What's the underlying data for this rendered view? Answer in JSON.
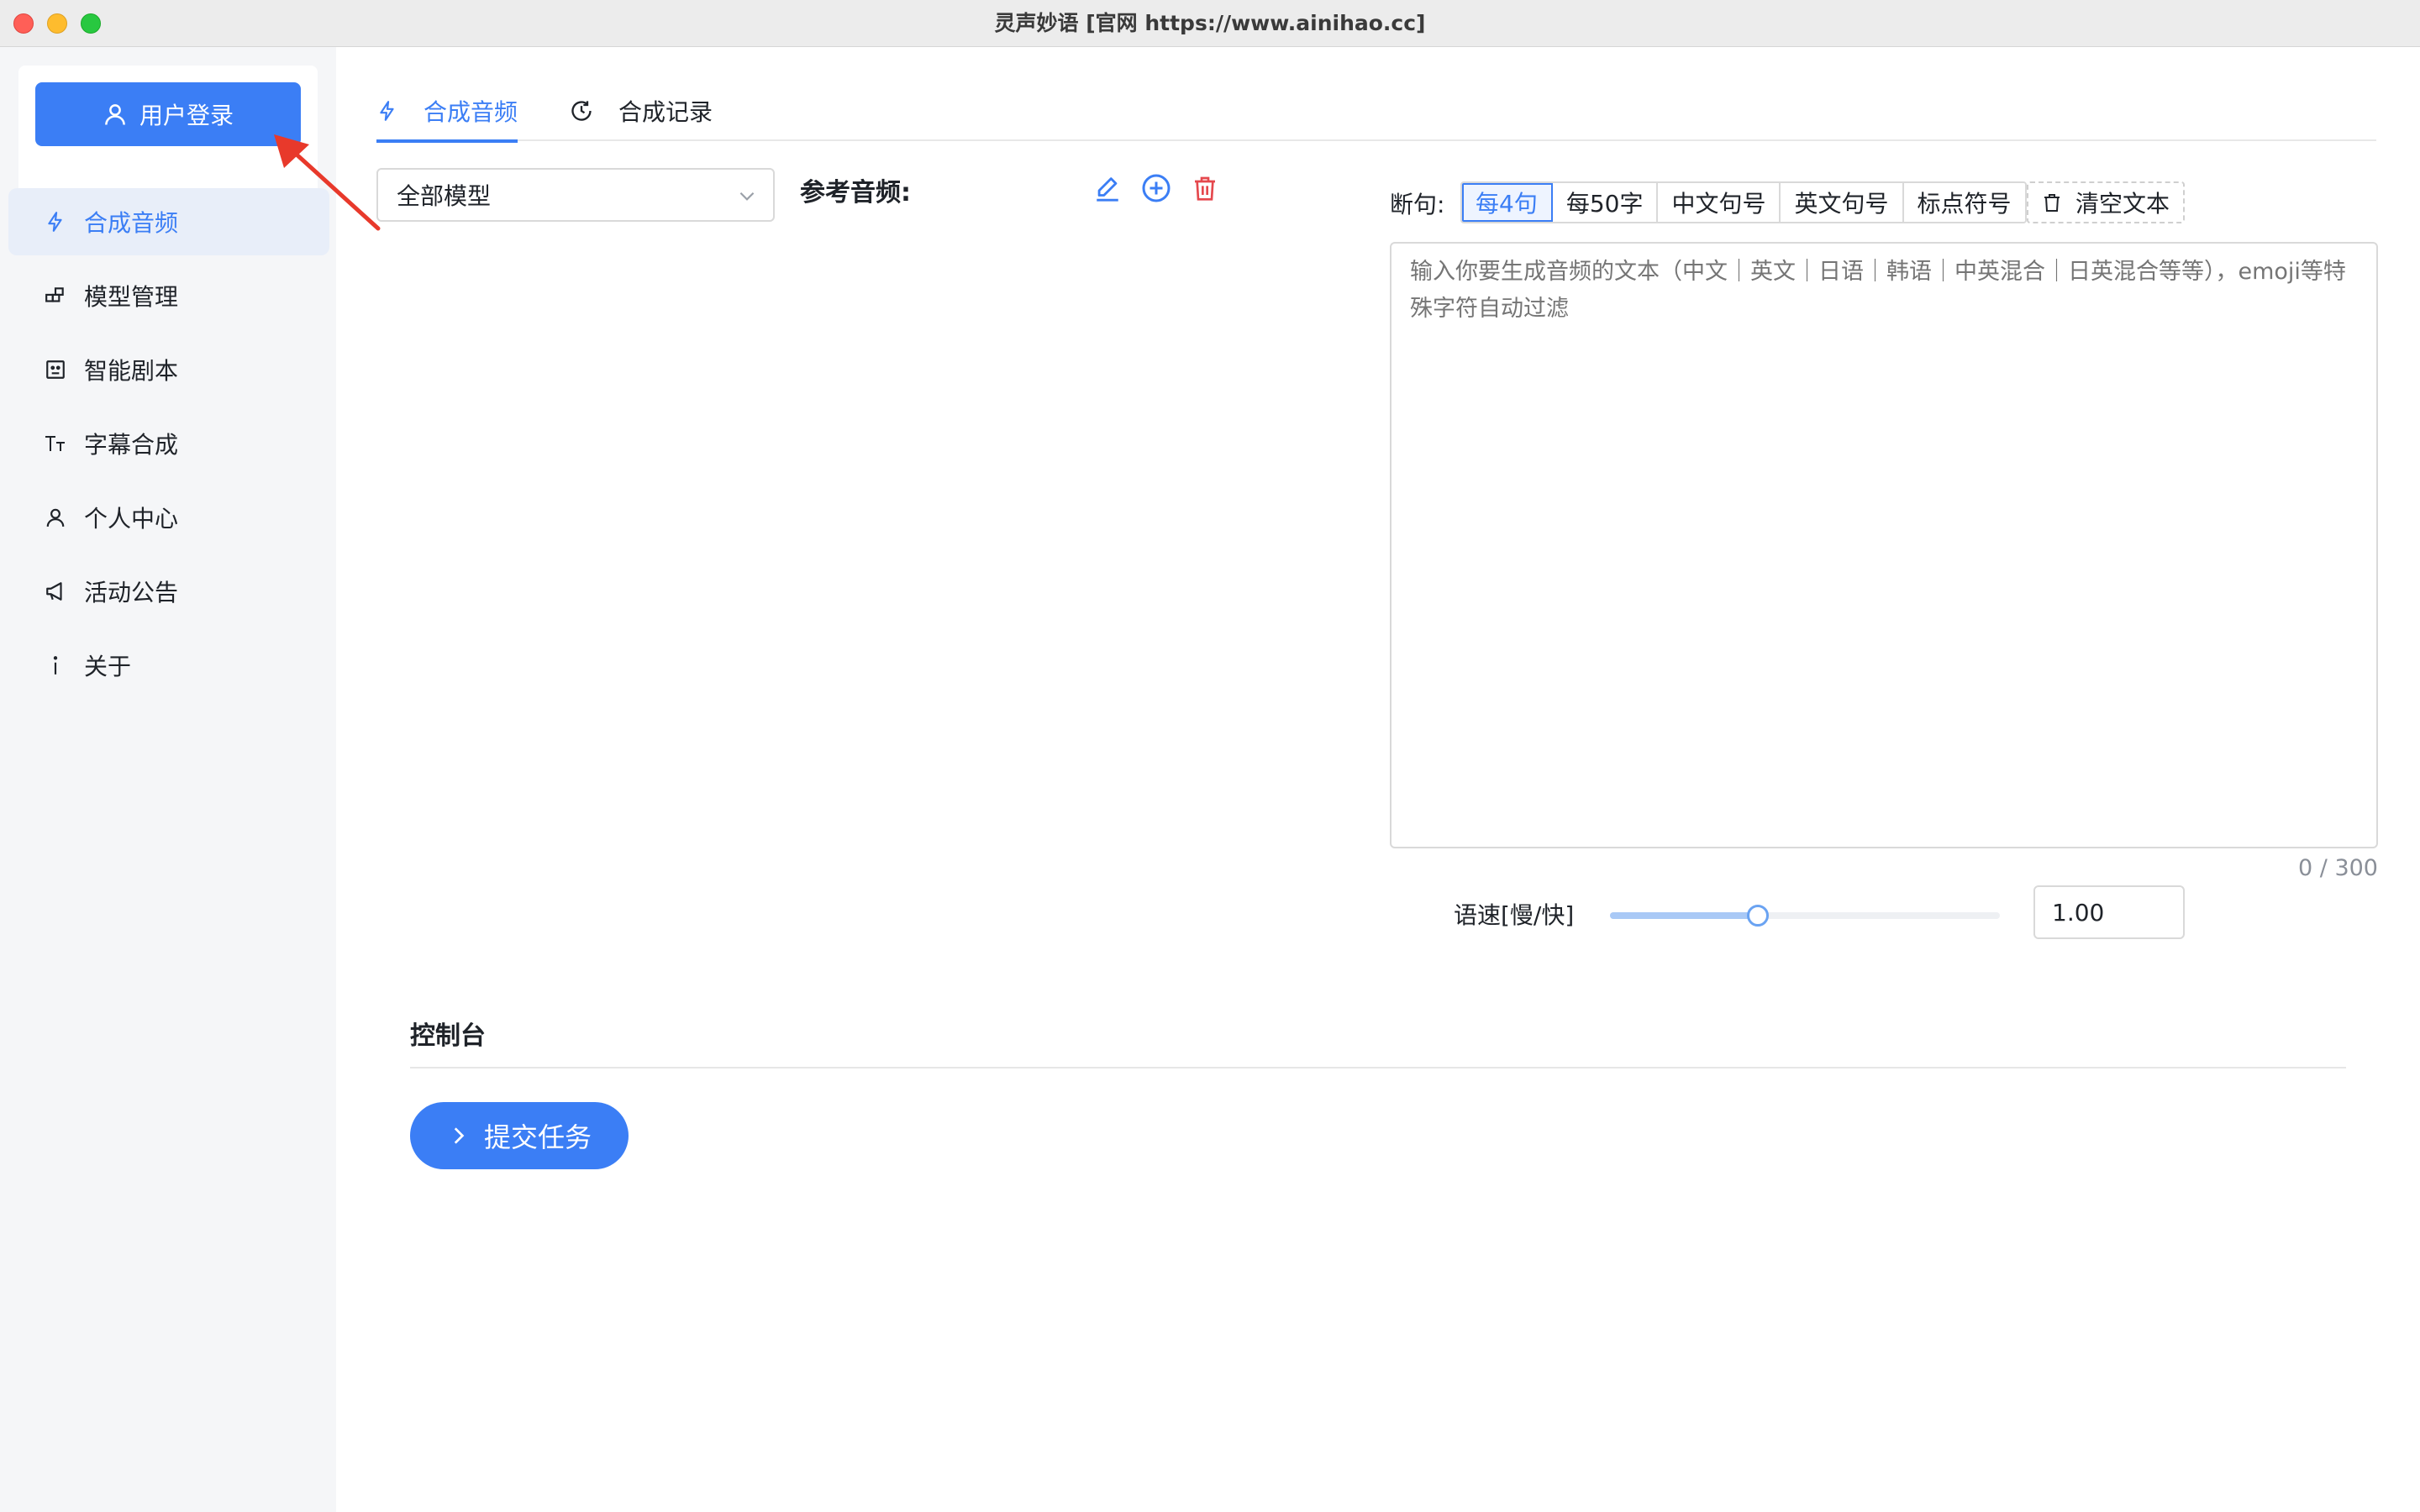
{
  "window": {
    "title": "灵声妙语 [官网 https://www.ainihao.cc]"
  },
  "sidebar": {
    "login_label": "用户登录",
    "items": [
      {
        "label": "合成音频",
        "icon": "lightning-icon",
        "active": true
      },
      {
        "label": "模型管理",
        "icon": "model-blocks-icon",
        "active": false
      },
      {
        "label": "智能剧本",
        "icon": "script-icon",
        "active": false
      },
      {
        "label": "字幕合成",
        "icon": "text-size-icon",
        "active": false
      },
      {
        "label": "个人中心",
        "icon": "user-icon",
        "active": false
      },
      {
        "label": "活动公告",
        "icon": "megaphone-icon",
        "active": false
      },
      {
        "label": "关于",
        "icon": "info-icon",
        "active": false
      }
    ]
  },
  "tabs": [
    {
      "label": "合成音频",
      "icon": "lightning-icon",
      "active": true
    },
    {
      "label": "合成记录",
      "icon": "history-icon",
      "active": false
    }
  ],
  "model_select": {
    "value": "全部模型"
  },
  "reference": {
    "label": "参考音频:"
  },
  "split": {
    "label": "断句:",
    "options": [
      "每4句",
      "每50字",
      "中文句号",
      "英文句号",
      "标点符号"
    ],
    "selected": "每4句",
    "clear_label": "清空文本"
  },
  "text_input": {
    "placeholder": "输入你要生成音频的文本（中文｜英文｜日语｜韩语｜中英混合｜日英混合等等），emoji等特殊字符自动过滤",
    "value": "",
    "counter": "0 / 300"
  },
  "speed": {
    "label": "语速[慢/快]",
    "value": "1.00",
    "level": 0.38
  },
  "console": {
    "title": "控制台",
    "submit_label": "提交任务"
  },
  "colors": {
    "accent": "#3b7ef5",
    "danger": "#e5484d",
    "annotation": "#e8392b"
  }
}
